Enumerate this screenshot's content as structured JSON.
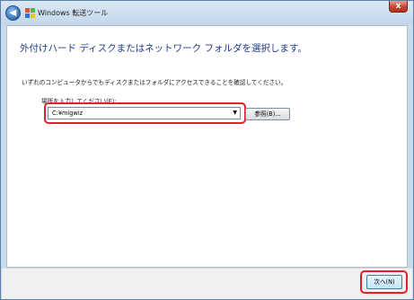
{
  "window": {
    "title": "Windows 転送ツール",
    "back_icon": "back-arrow-icon",
    "close_label": "x"
  },
  "main": {
    "heading": "外付けハード ディスクまたはネットワーク フォルダを選択します。",
    "description": "いずれのコンピュータからでもディスクまたはフォルダにアクセスできることを確認してください。",
    "location_label": "場所を入力してください(E):",
    "location_value": "C:¥migwiz",
    "browse_label": "参照(B)..."
  },
  "footer": {
    "next_label": "次へ(N)"
  },
  "colors": {
    "highlight": "#e0202a",
    "heading": "#1e3a8a"
  }
}
